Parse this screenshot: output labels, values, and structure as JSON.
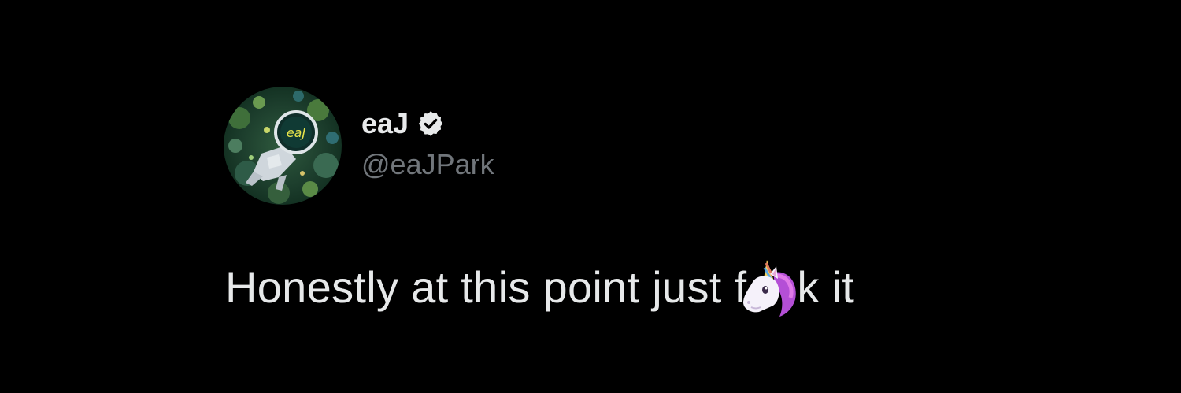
{
  "tweet": {
    "author": {
      "display_name": "eaJ",
      "handle": "@eaJPark",
      "verified": true,
      "verified_icon": "verified-badge-icon",
      "avatar_icon": "astronaut-avatar",
      "avatar_logo_text": "eaJ"
    },
    "text_before": "Honestly at this point just f",
    "emoji": "unicorn-emoji",
    "text_after": "k it"
  },
  "colors": {
    "background": "#000000",
    "primary_text": "#e7e9ea",
    "secondary_text": "#71767b"
  }
}
